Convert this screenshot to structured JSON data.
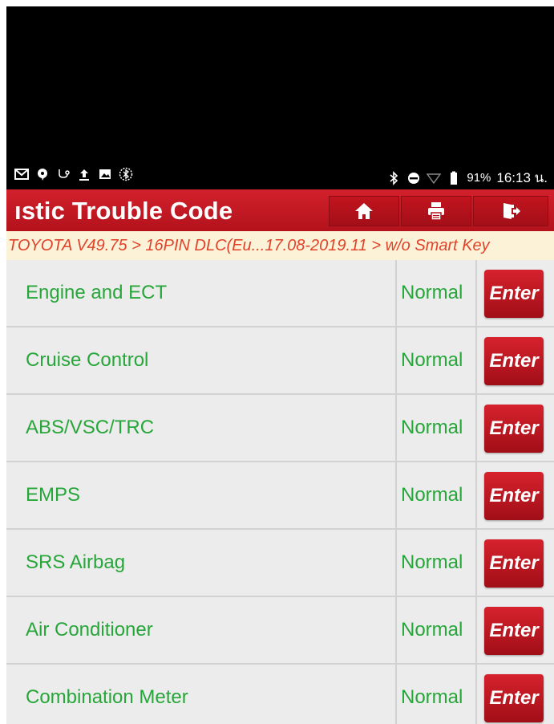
{
  "status_bar": {
    "left_icons": [
      "gmail-icon",
      "chat-icon",
      "usb-debug-icon",
      "upload-icon",
      "image-icon",
      "bluetooth-circle-icon"
    ],
    "right_icons": [
      "bluetooth-icon",
      "do-not-disturb-icon",
      "wifi-icon",
      "battery-icon"
    ],
    "battery": "91%",
    "time": "16:13 น."
  },
  "header": {
    "title": "ıstic Trouble Code",
    "buttons": [
      {
        "name": "home-icon"
      },
      {
        "name": "print-icon"
      },
      {
        "name": "exit-icon"
      }
    ]
  },
  "breadcrumb": "TOYOTA V49.75 > 16PIN DLC(Eu...17.08-2019.11 > w/o Smart Key",
  "systems": [
    {
      "name": "Engine and ECT",
      "status": "Normal",
      "action": "Enter"
    },
    {
      "name": "Cruise Control",
      "status": "Normal",
      "action": "Enter"
    },
    {
      "name": "ABS/VSC/TRC",
      "status": "Normal",
      "action": "Enter"
    },
    {
      "name": "EMPS",
      "status": "Normal",
      "action": "Enter"
    },
    {
      "name": "SRS Airbag",
      "status": "Normal",
      "action": "Enter"
    },
    {
      "name": "Air Conditioner",
      "status": "Normal",
      "action": "Enter"
    },
    {
      "name": "Combination Meter",
      "status": "Normal",
      "action": "Enter"
    }
  ],
  "colors": {
    "header_red": "#c41a25",
    "text_green": "#27a63a",
    "breadcrumb_bg": "#fcf2d7",
    "breadcrumb_text": "#e0432b"
  }
}
